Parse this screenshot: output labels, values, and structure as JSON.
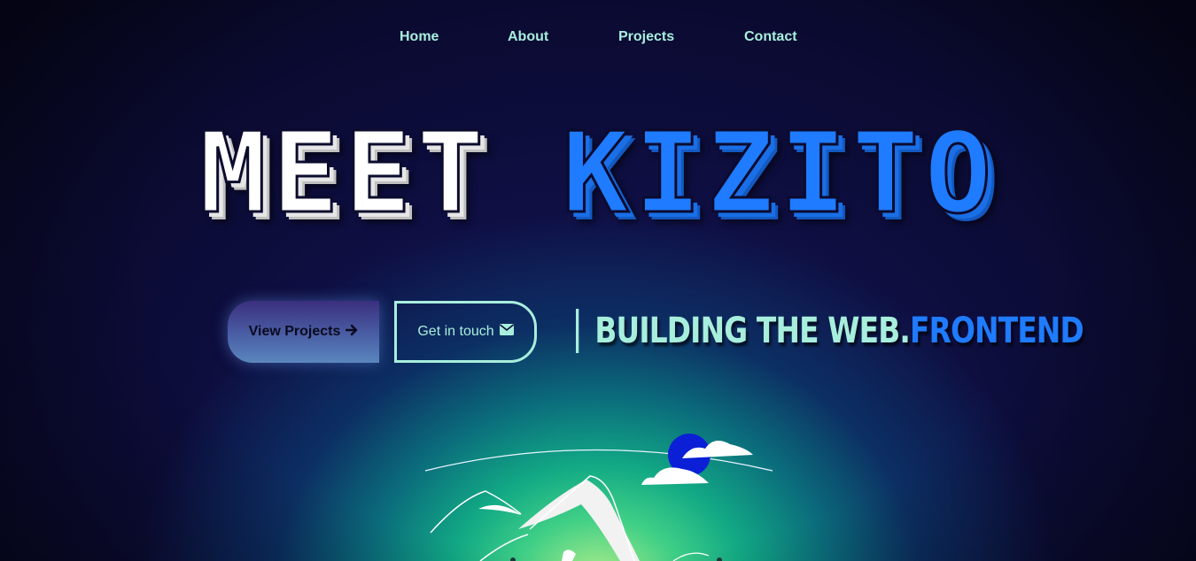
{
  "nav": {
    "items": [
      {
        "label": "Home"
      },
      {
        "label": "About"
      },
      {
        "label": "Projects"
      },
      {
        "label": "Contact"
      }
    ]
  },
  "hero": {
    "title_word1": "MEET",
    "title_word2": "KIZITO",
    "view_projects_label": "View Projects",
    "view_projects_icon": "arrow-right-icon",
    "get_in_touch_label": "Get in touch",
    "get_in_touch_icon": "envelope-icon",
    "tagline_part1": "BUILDING THE WEB.",
    "tagline_part2": "FRONTEND"
  },
  "colors": {
    "accent_mint": "#a8eedd",
    "accent_blue": "#1f7bff",
    "background": "#0b0b2e",
    "sun": "#0a1fd6"
  }
}
